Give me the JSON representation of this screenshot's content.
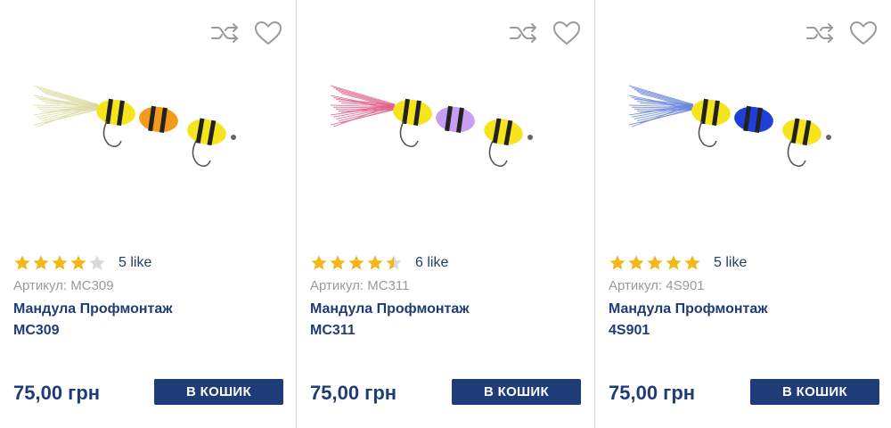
{
  "colors": {
    "accent": "#1f3c78",
    "star": "#f2b71a",
    "star_empty": "#d9d9d9",
    "border": "#d6d6d6"
  },
  "icons": {
    "compare": "shuffle-arrows-icon",
    "wishlist": "heart-outline-icon",
    "rating": "star-icon"
  },
  "products": [
    {
      "rating": 4,
      "rating_max": 5,
      "likes": "5 like",
      "sku_label": "Артикул: MC309",
      "title_line1": "Мандула Профмонтаж",
      "title_line2": "MC309",
      "price": "75,00 грн",
      "cart_label": "В КОШИК",
      "colors": {
        "tail": "#d9dba3",
        "seg_a": "#f6e41c",
        "seg_b": "#f39a1c",
        "stripe": "#222222"
      }
    },
    {
      "rating": 4.5,
      "rating_max": 5,
      "likes": "6 like",
      "sku_label": "Артикул: MC311",
      "title_line1": "Мандула Профмонтаж",
      "title_line2": "MC311",
      "price": "75,00 грн",
      "cart_label": "В КОШИК",
      "colors": {
        "tail": "#e0608a",
        "seg_a": "#f6e41c",
        "seg_b": "#c79ef2",
        "stripe": "#222222"
      }
    },
    {
      "rating": 5,
      "rating_max": 5,
      "likes": "5 like",
      "sku_label": "Артикул: 4S901",
      "title_line1": "Мандула Профмонтаж",
      "title_line2": "4S901",
      "price": "75,00 грн",
      "cart_label": "В КОШИК",
      "colors": {
        "tail": "#6a86d8",
        "seg_a": "#f6e41c",
        "seg_b": "#1f3fd8",
        "stripe": "#222222"
      }
    }
  ]
}
